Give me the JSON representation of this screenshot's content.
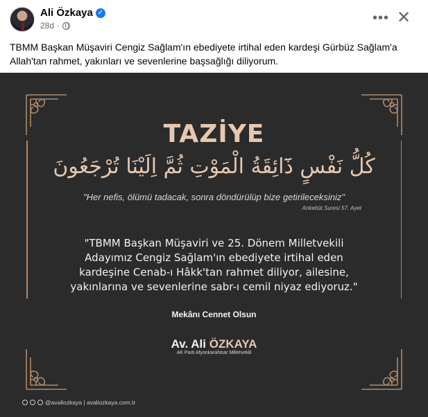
{
  "post": {
    "author": "Ali Özkaya",
    "time": "28d",
    "caption": "TBMM Başkan Müşaviri Cengiz Sağlam'ın ebediyete irtihal eden kardeşi Gürbüz Sağlam'a Allah'tan rahmet, yakınları ve sevenlerine başsağlığı diliyorum.",
    "more_label": "•••",
    "close_label": "✕"
  },
  "image": {
    "title": "TAZİYE",
    "arabic": "كُلُّ نَفْسٍ ذَٓائِقَةُ الْمَوْتِ ثُمَّ اِلَيْنَا تُرْجَعُونَ",
    "verse": "\"Her nefis, ölümü tadacak, sonra döndürülüp bize getirileceksiniz\"",
    "verse_source": "Ankebût Suresi 57. Ayet",
    "message": "\"TBMM Başkan Müşaviri ve 25. Dönem Milletvekili Adayımız Cengiz Sağlam'ın  ebediyete irtihal eden kardeşine Cenab-ı Hâkk'tan rahmet diliyor, ailesine, yakınlarına ve sevenlerine sabr-ı cemil niyaz ediyoruz.\"",
    "closing": "Mekânı Cennet Olsun",
    "signature_prefix": "Av. Ali ",
    "signature_name": "ÖZKAYA",
    "signature_title": "AK Parti Afyonkarahisar Milletvekili",
    "social_handle": "@avaliozkaya | avaliozkaya.com.tr"
  },
  "colors": {
    "accent": "#e6c7b0",
    "background": "#2b2b2b",
    "ornament": "#b08a6a",
    "verified": "#1877f2"
  },
  "icons": [
    "verified-badge-icon",
    "globe-icon",
    "more-options-icon",
    "close-icon",
    "corner-ornament-icon",
    "social-media-icons"
  ]
}
